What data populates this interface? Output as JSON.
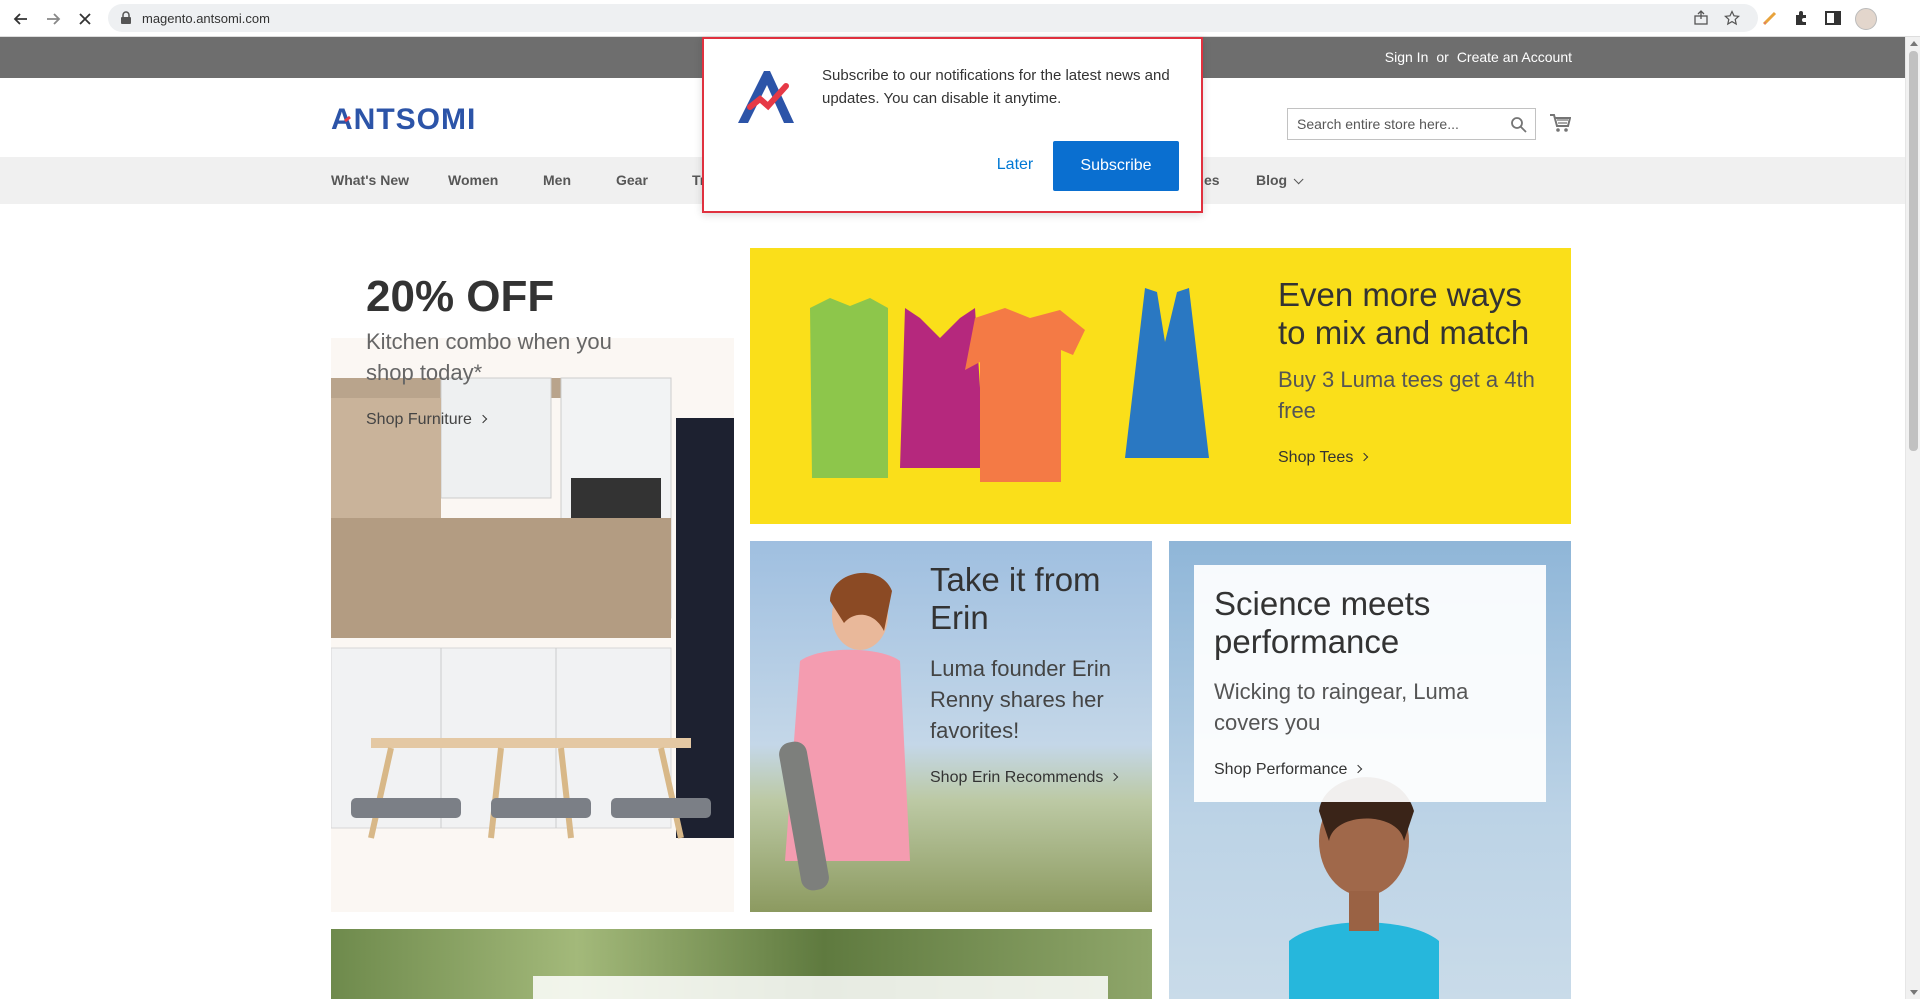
{
  "browser": {
    "url": "magento.antsomi.com"
  },
  "site": {
    "auth": {
      "sign_in": "Sign In",
      "or": "or",
      "create_account": "Create an Account"
    },
    "logo_text": "ANTSOMI",
    "search": {
      "placeholder": "Search entire store here..."
    },
    "nav": [
      {
        "label": "What's New"
      },
      {
        "label": "Women"
      },
      {
        "label": "Men"
      },
      {
        "label": "Gear"
      },
      {
        "label": "Tr"
      },
      {
        "label": "es"
      },
      {
        "label": "Blog"
      }
    ]
  },
  "promos": {
    "kitchen": {
      "title": "20% OFF",
      "subtitle": "Kitchen combo when you shop today*",
      "link": "Shop Furniture"
    },
    "tees": {
      "title": "Even more ways to mix and match",
      "body": "Buy 3 Luma tees get a 4th free",
      "link": "Shop Tees"
    },
    "erin": {
      "title": "Take it from Erin",
      "body": "Luma founder Erin Renny shares her favorites!",
      "link": "Shop Erin Recommends"
    },
    "performance": {
      "title": "Science meets performance",
      "body": "Wicking to raingear, Luma covers you",
      "link": "Shop Performance"
    }
  },
  "popup": {
    "message": "Subscribe to our notifications for the latest news and updates. You can disable it anytime.",
    "later_label": "Later",
    "subscribe_label": "Subscribe"
  },
  "colors": {
    "topbar": "#6e6e6e",
    "tees_bg": "#fadf1a",
    "subscribe_button": "#0a6fd0",
    "popup_border": "#e0313f"
  }
}
